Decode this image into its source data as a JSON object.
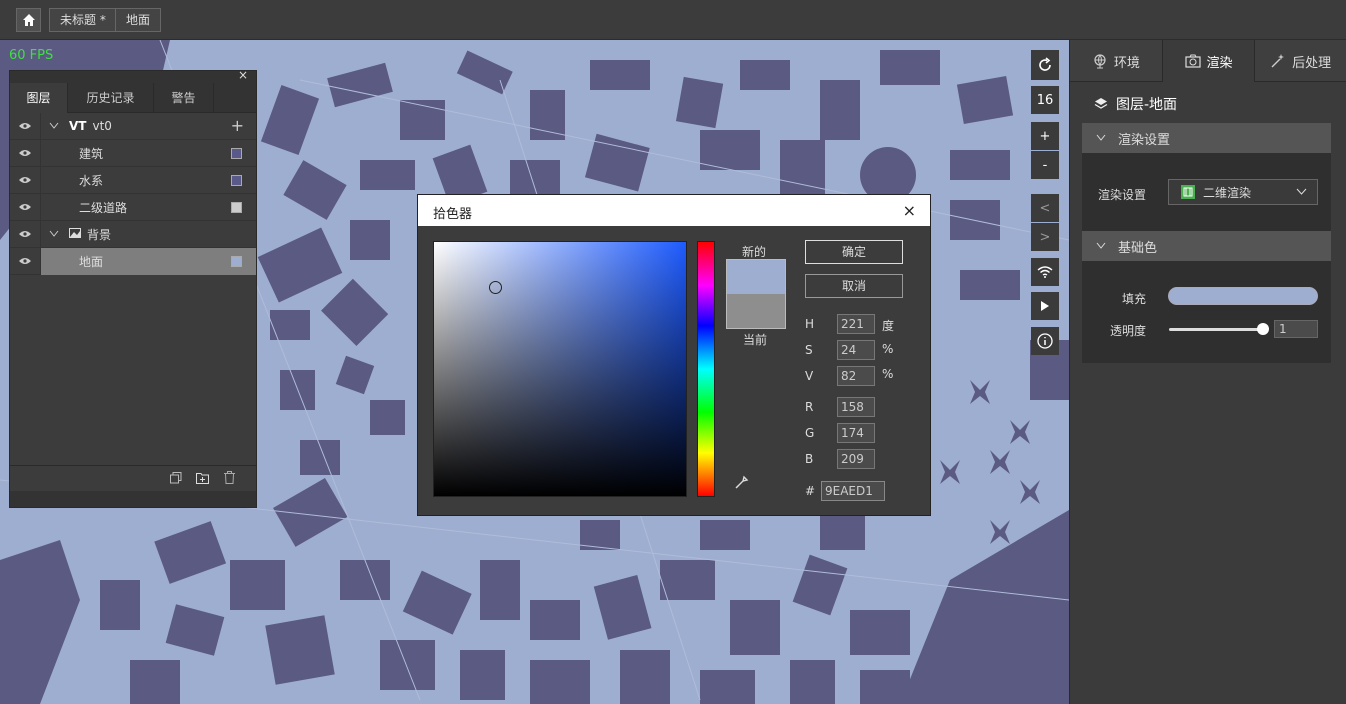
{
  "topbar": {
    "doc_title": "未标题 *",
    "layer_crumb": "地面"
  },
  "status": {
    "fps": "60 FPS"
  },
  "layer_panel": {
    "close": "×",
    "tabs": [
      {
        "label": "图层"
      },
      {
        "label": "历史记录"
      },
      {
        "label": "警告"
      }
    ],
    "vt_group": {
      "badge": "VT",
      "name": "vt0",
      "add": "+"
    },
    "layers": [
      {
        "label": "建筑",
        "color": "#5a5a8a"
      },
      {
        "label": "水系",
        "color": "#5a5a8a"
      },
      {
        "label": "二级道路",
        "color": "#cccccc"
      }
    ],
    "bg_group": {
      "name": "背景"
    },
    "bg_layer": {
      "label": "地面",
      "color": "#9eaed1"
    }
  },
  "map_toolbar": {
    "zoom_level": "16",
    "zoom_in": "+",
    "zoom_out": "-",
    "prev": "<",
    "next": ">"
  },
  "color_picker": {
    "title": "拾色器",
    "close": "×",
    "new_label": "新的",
    "current_label": "当前",
    "ok": "确定",
    "cancel": "取消",
    "new_color": "#9eaed1",
    "current_color": "#8e8e8e",
    "H": {
      "label": "H",
      "value": "221",
      "unit": "度"
    },
    "S": {
      "label": "S",
      "value": "24",
      "unit": "%"
    },
    "V": {
      "label": "V",
      "value": "82",
      "unit": "%"
    },
    "R": {
      "label": "R",
      "value": "158"
    },
    "G": {
      "label": "G",
      "value": "174"
    },
    "B": {
      "label": "B",
      "value": "209"
    },
    "hex_label": "#",
    "hex": "9EAED1"
  },
  "right_panel": {
    "tabs": [
      {
        "label": "环境"
      },
      {
        "label": "渲染"
      },
      {
        "label": "后处理"
      }
    ],
    "header": "图层-地面",
    "render_section": "渲染设置",
    "render_label": "渲染设置",
    "render_value": "二维渲染",
    "basecolor_section": "基础色",
    "fill_label": "填充",
    "fill_color": "#9eaed1",
    "opacity_label": "透明度",
    "opacity_value": "1"
  }
}
